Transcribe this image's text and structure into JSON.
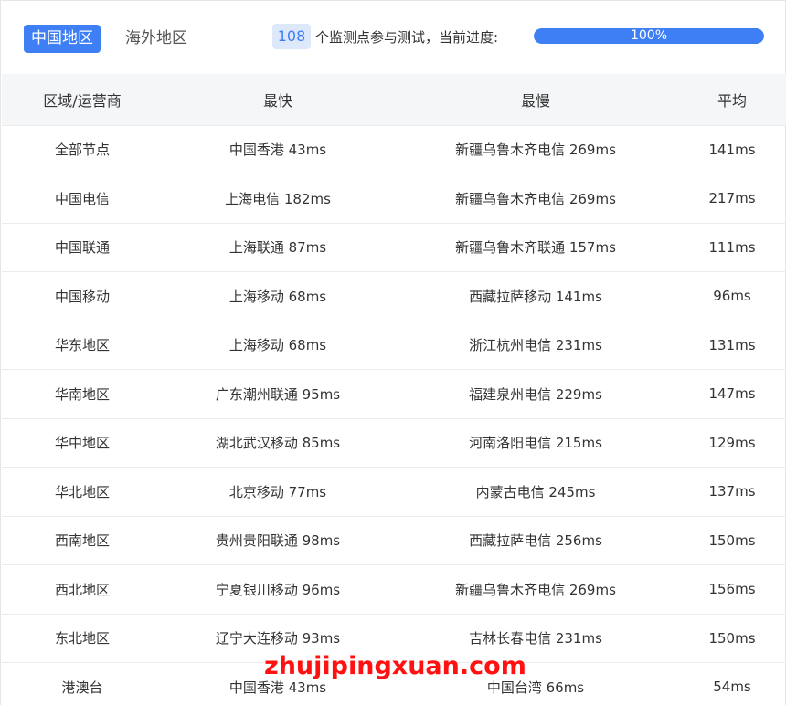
{
  "tabs": {
    "china": "中国地区",
    "overseas": "海外地区"
  },
  "status": {
    "node_count": "108",
    "text": "个监测点参与测试，当前进度:",
    "progress_label": "100%",
    "progress_fraction": 1.0
  },
  "table": {
    "headers": {
      "region": "区域/运营商",
      "fastest": "最快",
      "slowest": "最慢",
      "average": "平均"
    },
    "rows": [
      {
        "region": "全部节点",
        "fastest": "中国香港 43ms",
        "slowest": "新疆乌鲁木齐电信 269ms",
        "average": "141ms"
      },
      {
        "region": "中国电信",
        "fastest": "上海电信 182ms",
        "slowest": "新疆乌鲁木齐电信 269ms",
        "average": "217ms"
      },
      {
        "region": "中国联通",
        "fastest": "上海联通 87ms",
        "slowest": "新疆乌鲁木齐联通 157ms",
        "average": "111ms"
      },
      {
        "region": "中国移动",
        "fastest": "上海移动 68ms",
        "slowest": "西藏拉萨移动 141ms",
        "average": "96ms"
      },
      {
        "region": "华东地区",
        "fastest": "上海移动 68ms",
        "slowest": "浙江杭州电信 231ms",
        "average": "131ms"
      },
      {
        "region": "华南地区",
        "fastest": "广东潮州联通 95ms",
        "slowest": "福建泉州电信 229ms",
        "average": "147ms"
      },
      {
        "region": "华中地区",
        "fastest": "湖北武汉移动 85ms",
        "slowest": "河南洛阳电信 215ms",
        "average": "129ms"
      },
      {
        "region": "华北地区",
        "fastest": "北京移动 77ms",
        "slowest": "内蒙古电信 245ms",
        "average": "137ms"
      },
      {
        "region": "西南地区",
        "fastest": "贵州贵阳联通 98ms",
        "slowest": "西藏拉萨电信 256ms",
        "average": "150ms"
      },
      {
        "region": "西北地区",
        "fastest": "宁夏银川移动 96ms",
        "slowest": "新疆乌鲁木齐电信 269ms",
        "average": "156ms"
      },
      {
        "region": "东北地区",
        "fastest": "辽宁大连移动 93ms",
        "slowest": "吉林长春电信 231ms",
        "average": "150ms"
      },
      {
        "region": "港澳台",
        "fastest": "中国香港 43ms",
        "slowest": "中国台湾 66ms",
        "average": "54ms"
      }
    ]
  },
  "watermark": "zhujipingxuan.com",
  "colors": {
    "accent": "#3e7ff6",
    "badge_bg": "#dde8fb",
    "header_bg": "#f5f6f8",
    "watermark": "#ff1111"
  }
}
